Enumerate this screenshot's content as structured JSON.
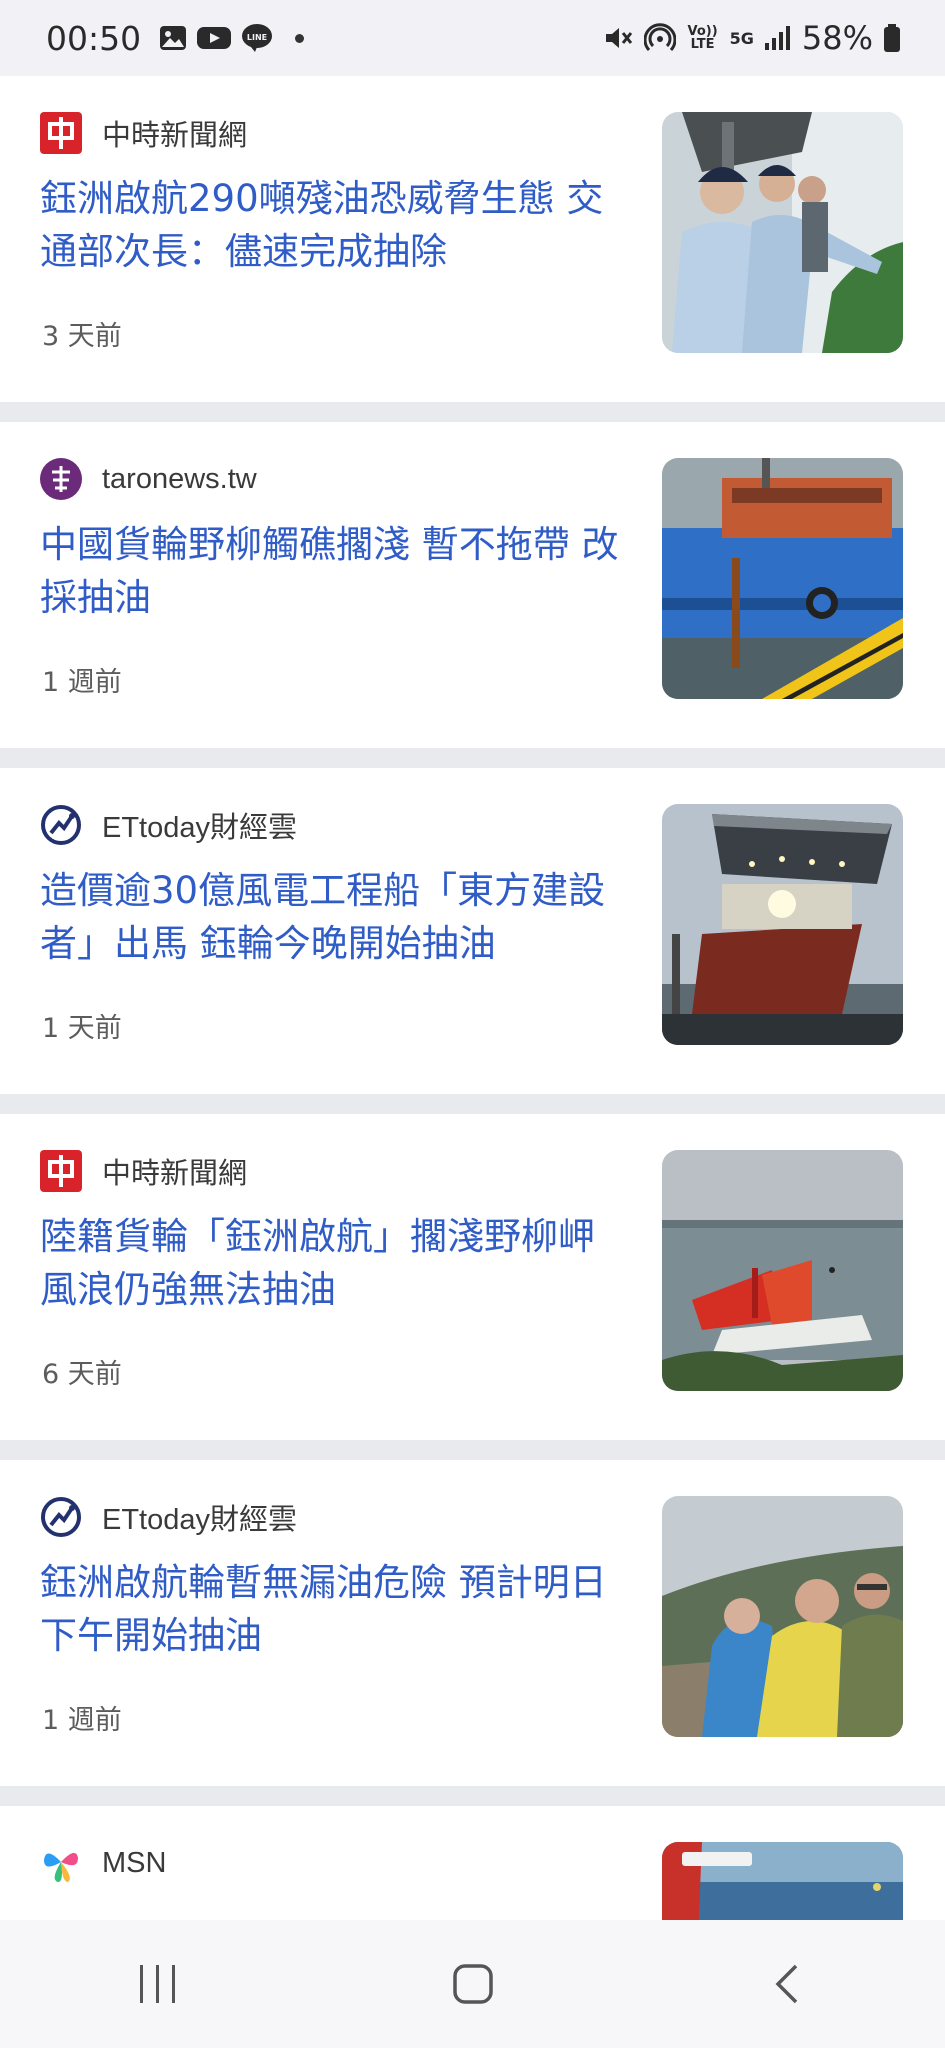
{
  "status_bar": {
    "time": "00:50",
    "battery": "58%",
    "volte_label": "Vo)) LTE",
    "network_label": "5G",
    "icons": [
      "image-icon",
      "youtube-icon",
      "line-icon",
      "mute-icon",
      "hotspot-icon",
      "volte-icon",
      "5g-icon",
      "signal-icon",
      "battery-icon"
    ]
  },
  "feed": {
    "items": [
      {
        "source": "中時新聞網",
        "logo": "chinatimes-logo",
        "headline": "鈺洲啟航290噸殘油恐威脅生態 交通部次長：儘速完成抽除",
        "time": "3 天前",
        "thumb": "officials-inspecting-coast"
      },
      {
        "source": "taronews.tw",
        "logo": "taronews-logo",
        "headline": "中國貨輪野柳觸礁擱淺 暫不拖帶 改採抽油",
        "time": "1 週前",
        "thumb": "blue-cargo-ship"
      },
      {
        "source": "ETtoday財經雲",
        "logo": "ettoday-logo",
        "headline": "造價逾30億風電工程船「東方建設者」出馬 鈺輪今晚開始抽油",
        "time": "1 天前",
        "thumb": "wind-power-engineering-vessel"
      },
      {
        "source": "中時新聞網",
        "logo": "chinatimes-logo",
        "headline": "陸籍貨輪「鈺洲啟航」擱淺野柳岬 風浪仍強無法抽油",
        "time": "6 天前",
        "thumb": "stranded-ship-in-waves"
      },
      {
        "source": "ETtoday財經雲",
        "logo": "ettoday-logo",
        "headline": "鈺洲啟航輪暫無漏油危險 預計明日下午開始抽油",
        "time": "1 週前",
        "thumb": "people-in-raincoats"
      },
      {
        "source": "MSN",
        "logo": "msn-logo",
        "headline": "",
        "time": "",
        "thumb": "sea-rescue-screenshot"
      }
    ]
  },
  "nav_bar": {
    "buttons": [
      "recent-apps-button",
      "home-button",
      "back-button"
    ]
  },
  "colors": {
    "headline": "#2f5cc6",
    "card_bg": "#ffffff",
    "separator": "#e9eaee",
    "chinatimes_red": "#d8232a",
    "taronews_purple": "#6b2b7a",
    "ettoday_navy": "#23326e"
  }
}
